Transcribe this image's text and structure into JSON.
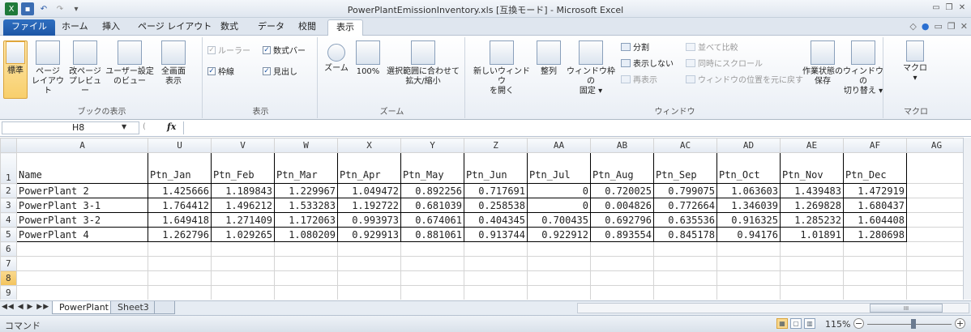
{
  "window": {
    "title": "PowerPlantEmissionInventory.xls [互換モード] - Microsoft Excel"
  },
  "tabs": {
    "file": "ファイル",
    "home": "ホーム",
    "insert": "挿入",
    "page_layout": "ページ レイアウト",
    "formulas": "数式",
    "data": "データ",
    "review": "校閲",
    "view": "表示"
  },
  "ribbon": {
    "workbook_views": {
      "label": "ブックの表示",
      "normal": "標準",
      "page_layout_line1": "ページ",
      "page_layout_line2": "レイアウト",
      "page_break_line1": "改ページ",
      "page_break_line2": "プレビュー",
      "custom_line1": "ユーザー設定",
      "custom_line2": "のビュー",
      "fullscreen_line1": "全画面",
      "fullscreen_line2": "表示"
    },
    "show": {
      "label": "表示",
      "ruler": "ルーラー",
      "formula_bar": "数式バー",
      "gridlines": "枠線",
      "headings": "見出し"
    },
    "zoom": {
      "label": "ズーム",
      "zoom": "ズーム",
      "hundred": "100%",
      "fit_line1": "選択範囲に合わせて",
      "fit_line2": "拡大/縮小"
    },
    "window": {
      "label": "ウィンドウ",
      "new_window_line1": "新しいウィンドウ",
      "new_window_line2": "を開く",
      "arrange": "整列",
      "freeze_line1": "ウィンドウ枠の",
      "freeze_line2": "固定 ▾",
      "split": "分割",
      "hide": "表示しない",
      "unhide": "再表示",
      "side_by_side": "並べて比較",
      "sync_scroll": "同時にスクロール",
      "reset_pos": "ウィンドウの位置を元に戻す",
      "save_ws_line1": "作業状態の",
      "save_ws_line2": "保存",
      "switch_line1": "ウィンドウの",
      "switch_line2": "切り替え ▾"
    },
    "macros": {
      "label": "マクロ",
      "macro": "マクロ",
      "arrow": "▾"
    }
  },
  "formula_bar": {
    "name_box": "H8",
    "fx": "fx",
    "value": ""
  },
  "grid": {
    "columns": [
      "A",
      "U",
      "V",
      "W",
      "X",
      "Y",
      "Z",
      "AA",
      "AB",
      "AC",
      "AD",
      "AE",
      "AF",
      "AG"
    ],
    "rows": [
      {
        "num": "1",
        "cells": [
          "Name",
          "Ptn_Jan",
          "Ptn_Feb",
          "Ptn_Mar",
          "Ptn_Apr",
          "Ptn_May",
          "Ptn_Jun",
          "Ptn_Jul",
          "Ptn_Aug",
          "Ptn_Sep",
          "Ptn_Oct",
          "Ptn_Nov",
          "Ptn_Dec",
          ""
        ]
      },
      {
        "num": "2",
        "cells": [
          "PowerPlant 2",
          "1.425666",
          "1.189843",
          "1.229967",
          "1.049472",
          "0.892256",
          "0.717691",
          "0",
          "0.720025",
          "0.799075",
          "1.063603",
          "1.439483",
          "1.472919",
          ""
        ]
      },
      {
        "num": "3",
        "cells": [
          "PowerPlant 3-1",
          "1.764412",
          "1.496212",
          "1.533283",
          "1.192722",
          "0.681039",
          "0.258538",
          "0",
          "0.004826",
          "0.772664",
          "1.346039",
          "1.269828",
          "1.680437",
          ""
        ]
      },
      {
        "num": "4",
        "cells": [
          "PowerPlant 3-2",
          "1.649418",
          "1.271409",
          "1.172063",
          "0.993973",
          "0.674061",
          "0.404345",
          "0.700435",
          "0.692796",
          "0.635536",
          "0.916325",
          "1.285232",
          "1.604408",
          ""
        ]
      },
      {
        "num": "5",
        "cells": [
          "PowerPlant 4",
          "1.262796",
          "1.029265",
          "1.080209",
          "0.929913",
          "0.881061",
          "0.913744",
          "0.922912",
          "0.893554",
          "0.845178",
          "0.94176",
          "1.01891",
          "1.280698",
          ""
        ]
      },
      {
        "num": "6",
        "cells": [
          "",
          "",
          "",
          "",
          "",
          "",
          "",
          "",
          "",
          "",
          "",
          "",
          "",
          ""
        ]
      },
      {
        "num": "7",
        "cells": [
          "",
          "",
          "",
          "",
          "",
          "",
          "",
          "",
          "",
          "",
          "",
          "",
          "",
          ""
        ]
      },
      {
        "num": "8",
        "cells": [
          "",
          "",
          "",
          "",
          "",
          "",
          "",
          "",
          "",
          "",
          "",
          "",
          "",
          ""
        ]
      },
      {
        "num": "9",
        "cells": [
          "",
          "",
          "",
          "",
          "",
          "",
          "",
          "",
          "",
          "",
          "",
          "",
          "",
          ""
        ]
      }
    ]
  },
  "sheets": {
    "active": "PowerPlant",
    "other": "Sheet3"
  },
  "status": {
    "mode": "コマンド",
    "zoom": "115%"
  }
}
